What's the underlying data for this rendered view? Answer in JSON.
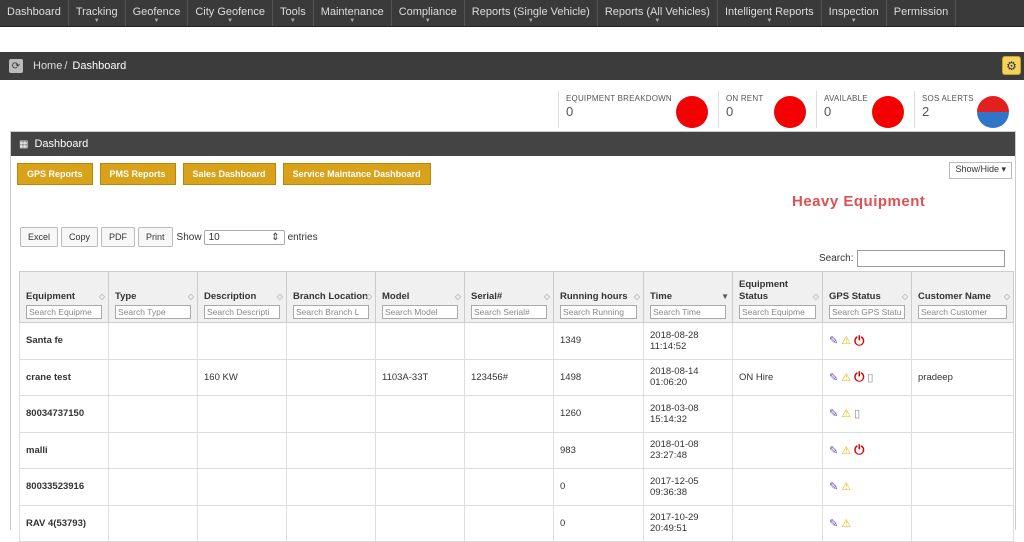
{
  "nav": [
    "Dashboard",
    "Tracking",
    "Geofence",
    "City Geofence",
    "Tools",
    "Maintenance",
    "Compliance",
    "Reports (Single Vehicle)",
    "Reports (All Vehicles)",
    "Intelligent Reports",
    "Inspection",
    "Permission"
  ],
  "breadcrumb": {
    "home": "Home",
    "sep": "/",
    "current": "Dashboard"
  },
  "stats": [
    {
      "label": "EQUIPMENT BREAKDOWN",
      "value": "0",
      "color": "#f40000"
    },
    {
      "label": "ON RENT",
      "value": "0",
      "color": "#f40000"
    },
    {
      "label": "AVAILABLE",
      "value": "0",
      "color": "#f40000"
    },
    {
      "label": "SOS ALERTS",
      "value": "2",
      "color": "#e22020/#2f76c8"
    }
  ],
  "panel": {
    "title": "Dashboard"
  },
  "buttons": [
    "GPS Reports",
    "PMS Reports",
    "Sales Dashboard",
    "Service Maintance Dashboard"
  ],
  "show_hide": "Show/Hide ▾",
  "heavy_title": "Heavy Equipment",
  "tools": {
    "excel": "Excel",
    "copy": "Copy",
    "pdf": "PDF",
    "print": "Print",
    "show": "Show",
    "entries_value": "10",
    "entries": "entries",
    "search": "Search:"
  },
  "columns": [
    {
      "label": "Equipment",
      "search": "Search Equipme"
    },
    {
      "label": "Type",
      "search": "Search Type"
    },
    {
      "label": "Description",
      "search": "Search Descripti"
    },
    {
      "label": "Branch Location",
      "search": "Search Branch L"
    },
    {
      "label": "Model",
      "search": "Search Model"
    },
    {
      "label": "Serial#",
      "search": "Search Serial#"
    },
    {
      "label": "Running hours",
      "search": "Search Running"
    },
    {
      "label": "Time",
      "search": "Search Time"
    },
    {
      "label": "Equipment Status",
      "search": "Search Equipme"
    },
    {
      "label": "GPS Status",
      "search": "Search GPS Statu"
    },
    {
      "label": "Customer Name",
      "search": "Search Customer"
    }
  ],
  "rows": [
    {
      "equipment": "Santa fe",
      "type": "",
      "description": "",
      "branch": "",
      "model": "",
      "serial": "",
      "hours": "1349",
      "time": "2018-08-28 11:14:52",
      "status": "",
      "gps": [
        "satellite-icon",
        "warning-icon",
        "power-icon"
      ],
      "customer": ""
    },
    {
      "equipment": "crane test",
      "type": "",
      "description": "160 KW",
      "branch": "",
      "model": "1103A-33T",
      "serial": "123456#",
      "hours": "1498",
      "time": "2018-08-14 01:06:20",
      "status": "ON Hire",
      "gps": [
        "satellite-icon",
        "warning-icon",
        "power-icon",
        "battery-icon"
      ],
      "customer": "pradeep"
    },
    {
      "equipment": "80034737150",
      "type": "",
      "description": "",
      "branch": "",
      "model": "",
      "serial": "",
      "hours": "1260",
      "time": "2018-03-08 15:14:32",
      "status": "",
      "gps": [
        "satellite-icon",
        "warning-icon",
        "battery-icon"
      ],
      "customer": ""
    },
    {
      "equipment": "malli",
      "type": "",
      "description": "",
      "branch": "",
      "model": "",
      "serial": "",
      "hours": "983",
      "time": "2018-01-08 23:27:48",
      "status": "",
      "gps": [
        "satellite-icon",
        "warning-icon",
        "power-icon"
      ],
      "customer": ""
    },
    {
      "equipment": "80033523916",
      "type": "",
      "description": "",
      "branch": "",
      "model": "",
      "serial": "",
      "hours": "0",
      "time": "2017-12-05 09:36:38",
      "status": "",
      "gps": [
        "satellite-icon",
        "warning-icon"
      ],
      "customer": ""
    },
    {
      "equipment": "RAV 4(53793)",
      "type": "",
      "description": "",
      "branch": "",
      "model": "",
      "serial": "",
      "hours": "0",
      "time": "2017-10-29 20:49:51",
      "status": "",
      "gps": [
        "satellite-icon",
        "warning-icon"
      ],
      "customer": ""
    }
  ]
}
